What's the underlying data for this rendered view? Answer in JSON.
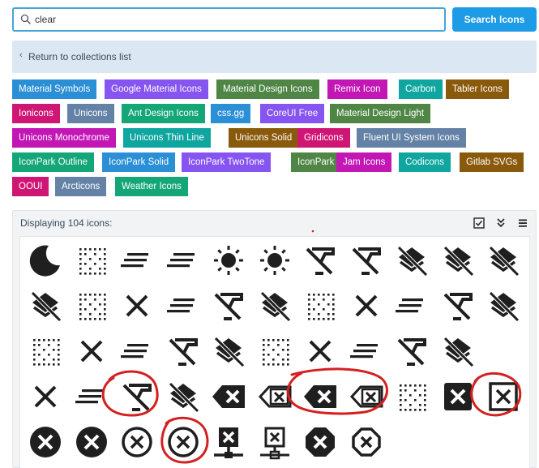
{
  "search": {
    "value": "clear",
    "button_label": "Search Icons"
  },
  "back": {
    "label": "Return to collections list"
  },
  "collections": [
    [
      {
        "label": "Material Symbols",
        "color": "#2b8fd6"
      },
      {
        "label": "Google Material Icons",
        "color": "#8654f0"
      },
      {
        "label": "Material Design Icons",
        "color": "#4f8646"
      },
      {
        "label": "Remix Icon",
        "color": "#c317b5"
      },
      {
        "label": "Carbon",
        "color": "#10a6a0"
      },
      {
        "label": "Tabler Icons",
        "color": "#8a5a0c"
      }
    ],
    [
      {
        "label": "Ionicons",
        "color": "#d01674"
      },
      {
        "label": "Unicons",
        "color": "#6382a5"
      },
      {
        "label": "Ant Design Icons",
        "color": "#14a676"
      },
      {
        "label": "css.gg",
        "color": "#2b8fd6"
      },
      {
        "label": "CoreUI Free",
        "color": "#8654f0"
      },
      {
        "label": "Material Design Light",
        "color": "#4f8646"
      }
    ],
    [
      {
        "label": "Unicons Monochrome",
        "color": "#c317b5"
      },
      {
        "label": "Unicons Thin Line",
        "color": "#10a6a0"
      },
      {
        "label": "Unicons Solid",
        "color": "#8a5a0c"
      },
      {
        "label": "Gridicons",
        "color": "#d01674"
      },
      {
        "label": "Fluent UI System Icons",
        "color": "#6382a5"
      }
    ],
    [
      {
        "label": "IconPark Outline",
        "color": "#14a676"
      },
      {
        "label": "IconPark Solid",
        "color": "#2b8fd6"
      },
      {
        "label": "IconPark TwoTone",
        "color": "#8654f0"
      },
      {
        "label": "IconPark",
        "color": "#4f8646"
      },
      {
        "label": "Jam Icons",
        "color": "#c317b5"
      },
      {
        "label": "Codicons",
        "color": "#10a6a0"
      },
      {
        "label": "Gitlab SVGs",
        "color": "#8a5a0c"
      }
    ],
    [
      {
        "label": "OOUI",
        "color": "#d01674"
      },
      {
        "label": "Arcticons",
        "color": "#6382a5"
      },
      {
        "label": "Weather Icons",
        "color": "#14a676"
      }
    ]
  ],
  "results": {
    "count_label": "Displaying 104 icons:",
    "tools": [
      "checkbox-icon",
      "double-chevron-down-icon",
      "menu-icon"
    ],
    "icons": [
      [
        "moon-icon",
        "clear-all-dots-icon",
        "clear-all-lines-icon",
        "clear-all-lines-icon",
        "sun-clear-icon",
        "sun-clear-icon",
        "format-clear-icon",
        "format-clear-icon",
        "layers-clear-icon",
        "layers-clear-icon",
        "layers-clear-icon"
      ],
      [
        "layers-clear-icon",
        "clear-all-dots-icon",
        "close-icon",
        "clear-all-lines-icon",
        "format-clear-icon",
        "layers-clear-icon",
        "clear-all-dots-icon",
        "close-icon",
        "clear-all-lines-icon",
        "format-clear-icon",
        "layers-clear-icon"
      ],
      [
        "clear-all-dots-icon",
        "close-icon",
        "clear-all-lines-icon",
        "format-clear-icon",
        "layers-clear-icon",
        "clear-all-dots-icon",
        "close-icon",
        "clear-all-lines-icon",
        "format-clear-icon",
        "layers-clear-icon",
        ""
      ],
      [
        "close-icon",
        "clear-all-lines-icon",
        "format-clear-icon",
        "layers-clear-icon",
        "backspace-icon",
        "backspace-outline-icon",
        "backspace-icon",
        "backspace-outline-icon",
        "clear-all-dots-icon",
        "close-box-icon",
        "close-box-outline-icon"
      ],
      [
        "close-circle-icon",
        "close-circle-icon",
        "close-circle-outline-icon",
        "close-circle-outline-icon",
        "network-clear-icon",
        "network-clear-outline-icon",
        "octagon-close-icon",
        "octagon-close-outline-icon",
        "",
        "",
        ""
      ]
    ]
  }
}
